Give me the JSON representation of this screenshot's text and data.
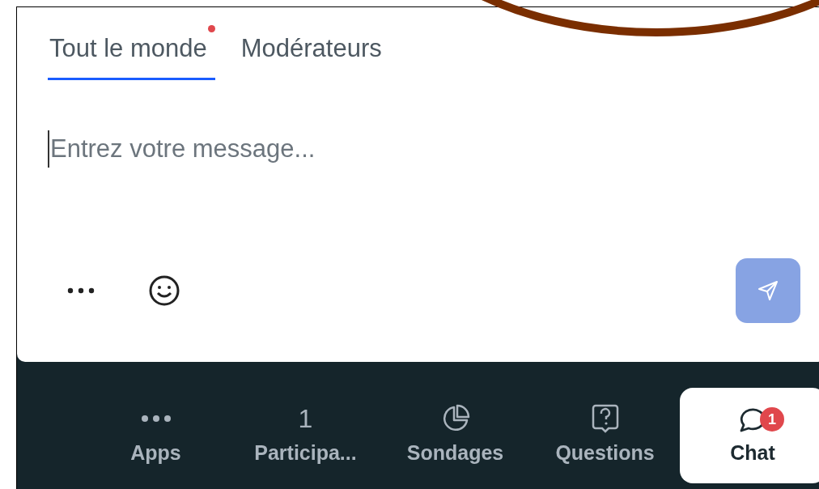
{
  "tabs": [
    {
      "label": "Tout le monde",
      "selected": true,
      "unread": true
    },
    {
      "label": "Modérateurs",
      "selected": false,
      "unread": false
    }
  ],
  "composer": {
    "placeholder": "Entrez votre message..."
  },
  "nav": [
    {
      "label": "Apps",
      "kind": "dots",
      "selected": false
    },
    {
      "label": "Participa...",
      "kind": "count",
      "count": "1",
      "selected": false
    },
    {
      "label": "Sondages",
      "kind": "pie",
      "selected": false
    },
    {
      "label": "Questions",
      "kind": "question",
      "selected": false
    },
    {
      "label": "Chat",
      "kind": "chat",
      "badge": "1",
      "selected": true
    }
  ]
}
